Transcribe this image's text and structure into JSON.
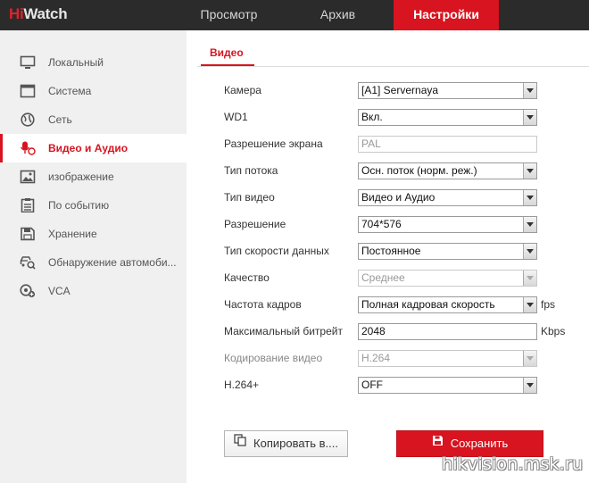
{
  "brand": {
    "hi": "Hi",
    "watch": "Watch"
  },
  "nav": {
    "items": [
      {
        "label": "Просмотр"
      },
      {
        "label": "Архив"
      },
      {
        "label": "Настройки"
      }
    ],
    "active": "Настройки"
  },
  "sidebar": {
    "items": [
      {
        "label": "Локальный",
        "icon": "monitor-icon"
      },
      {
        "label": "Система",
        "icon": "system-window-icon"
      },
      {
        "label": "Сеть",
        "icon": "globe-icon"
      },
      {
        "label": "Видео и Аудио",
        "icon": "microphone-icon"
      },
      {
        "label": "изображение",
        "icon": "image-icon"
      },
      {
        "label": "По событию",
        "icon": "event-list-icon"
      },
      {
        "label": "Хранение",
        "icon": "floppy-icon"
      },
      {
        "label": "Обнаружение автомоби...",
        "icon": "car-search-icon"
      },
      {
        "label": "VCA",
        "icon": "vca-icon"
      }
    ],
    "active": "Видео и Аудио"
  },
  "tabs": {
    "video": "Видео"
  },
  "form": {
    "camera": {
      "label": "Камера",
      "value": "[A1] Servernaya"
    },
    "wd1": {
      "label": "WD1",
      "value": "Вкл."
    },
    "resolution_screen": {
      "label": "Разрешение экрана",
      "value": "PAL"
    },
    "stream_type": {
      "label": "Тип потока",
      "value": "Осн. поток (норм. реж.)"
    },
    "video_type": {
      "label": "Тип видео",
      "value": "Видео и Аудио"
    },
    "resolution": {
      "label": "Разрешение",
      "value": "704*576"
    },
    "bitrate_type": {
      "label": "Тип скорости данных",
      "value": "Постоянное"
    },
    "quality": {
      "label": "Качество",
      "value": "Среднее"
    },
    "frame_rate": {
      "label": "Частота кадров",
      "value": "Полная кадровая скорость",
      "unit": "fps"
    },
    "max_bitrate": {
      "label": "Максимальный битрейт",
      "value": "2048",
      "unit": "Kbps"
    },
    "encoding": {
      "label": "Кодирование видео",
      "value": "H.264"
    },
    "h264plus": {
      "label": "H.264+",
      "value": "OFF"
    }
  },
  "buttons": {
    "copy": "Копировать в....",
    "save": "Сохранить"
  },
  "watermark": "hikvision.msk.ru",
  "colors": {
    "accent": "#d7141f",
    "topbar": "#2b2b2b",
    "sidebar": "#f0f0f0"
  }
}
